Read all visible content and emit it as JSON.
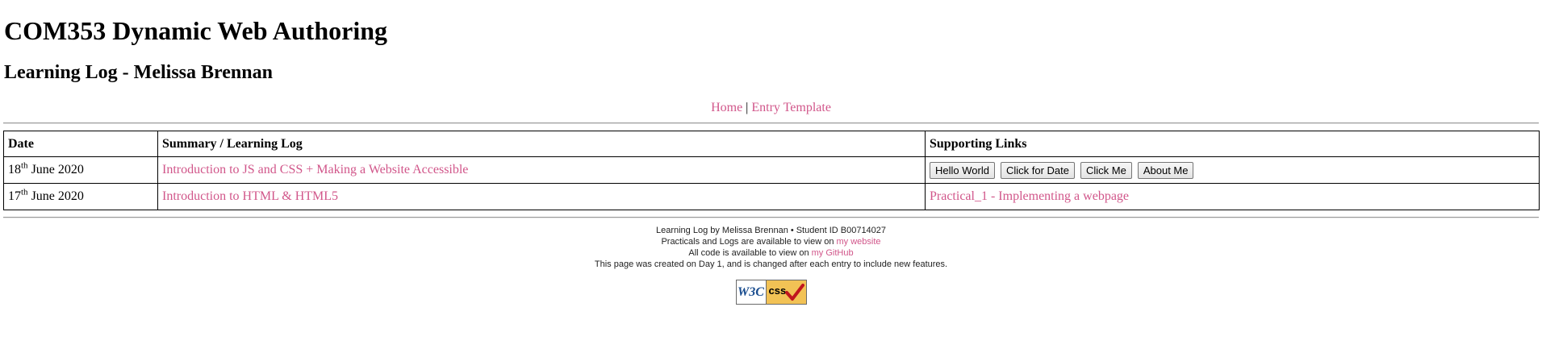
{
  "header": {
    "title": "COM353 Dynamic Web Authoring",
    "subtitle": "Learning Log - Melissa Brennan"
  },
  "nav": {
    "home": "Home",
    "separator": "|",
    "entry_template": "Entry Template"
  },
  "table": {
    "headers": {
      "date": "Date",
      "summary": "Summary / Learning Log",
      "links": "Supporting Links"
    },
    "rows": [
      {
        "date_day": "18",
        "date_suffix": "th",
        "date_rest": "June 2020",
        "summary": "Introduction to JS and CSS + Making a Website Accessible",
        "buttons": [
          "Hello World",
          "Click for Date",
          "Click Me",
          "About Me"
        ]
      },
      {
        "date_day": "17",
        "date_suffix": "th",
        "date_rest": "June 2020",
        "summary": "Introduction to HTML & HTML5",
        "link": "Practical_1 - Implementing a webpage"
      }
    ]
  },
  "footer": {
    "line1_a": "Learning Log by Melissa Brennan",
    "line1_sep": "•",
    "line1_b": "Student ID B00714027",
    "line2_text": "Practicals and Logs are available to view on",
    "line2_link": "my website",
    "line3_text": "All code is available to view on",
    "line3_link": "my GitHub",
    "line4": "This page was created on Day 1, and is changed after each entry to include new features."
  },
  "badge": {
    "w3c": "W3C",
    "css": "css",
    "icon": "checkmark-icon",
    "check_color": "#c0161e"
  },
  "colors": {
    "link": "#d1568a",
    "badge_bg": "#f2c255",
    "w3c_blue": "#1a4d8f"
  }
}
